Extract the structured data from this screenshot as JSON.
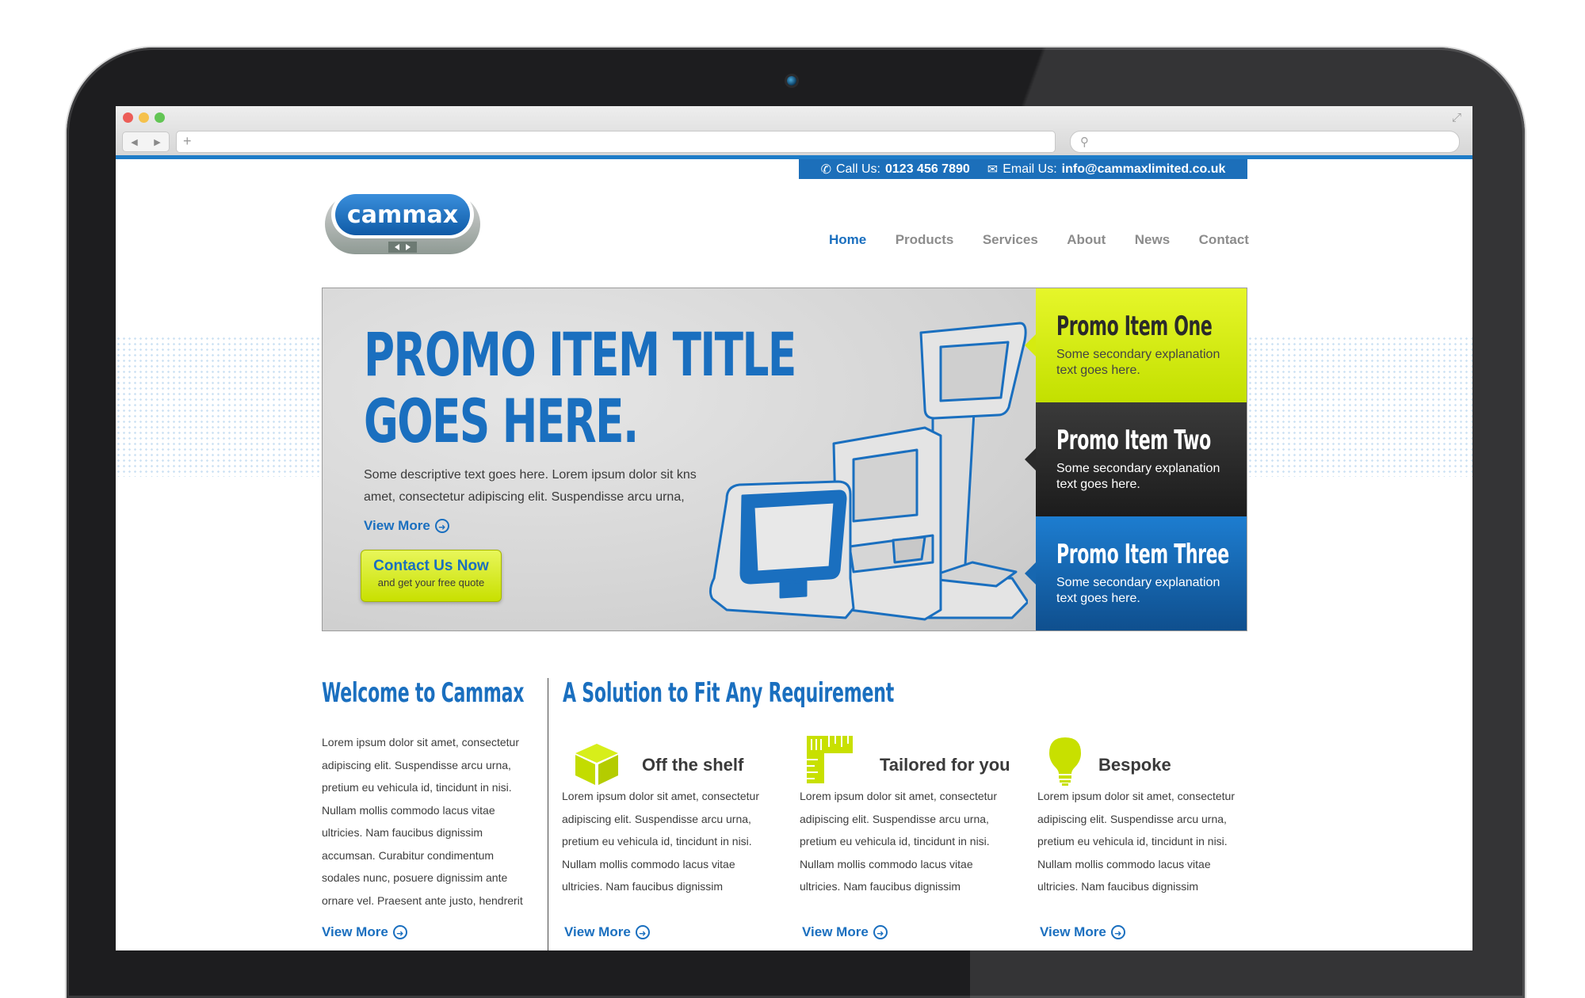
{
  "browser": {
    "nav_back": "◀",
    "nav_forward": "▶",
    "new_tab": "+"
  },
  "header": {
    "call_label": "Call Us:",
    "call_number": "0123 456 7890",
    "email_label": "Email Us:",
    "email_address": "info@cammaxlimited.co.uk",
    "logo_text": "cammax"
  },
  "nav": {
    "items": [
      "Home",
      "Products",
      "Services",
      "About",
      "News",
      "Contact"
    ],
    "active": "Home"
  },
  "hero": {
    "title_line1": "PROMO ITEM TITLE",
    "title_line2": "GOES HERE.",
    "description": "Some descriptive text goes here. Lorem ipsum dolor sit kns amet, consectetur adipiscing elit. Suspendisse arcu urna,",
    "view_more": "View More",
    "cta_title": "Contact Us Now",
    "cta_subtitle": "and get your free quote"
  },
  "promos": [
    {
      "title": "Promo Item One",
      "text": "Some secondary explanation text goes here."
    },
    {
      "title": "Promo Item Two",
      "text": "Some secondary explanation text goes here."
    },
    {
      "title": "Promo Item Three",
      "text": "Some secondary explanation text goes here."
    }
  ],
  "welcome": {
    "title": "Welcome to Cammax",
    "text": "Lorem ipsum dolor sit amet, consectetur adipiscing elit. Suspendisse arcu urna, pretium eu vehicula id, tincidunt in nisi. Nullam mollis commodo lacus vitae ultricies. Nam faucibus dignissim accumsan. Curabitur condimentum sodales nunc, posuere dignissim ante ornare vel. Praesent ante justo, hendrerit",
    "view_more": "View More"
  },
  "solution": {
    "title": "A Solution to Fit Any Requirement",
    "features": [
      {
        "icon": "box-icon",
        "title": "Off the shelf",
        "text": "Lorem ipsum dolor sit amet, consectetur adipiscing elit. Suspendisse arcu urna, pretium eu vehicula id, tincidunt in nisi. Nullam mollis commodo lacus vitae ultricies. Nam faucibus dignissim",
        "view_more": "View More"
      },
      {
        "icon": "ruler-icon",
        "title": "Tailored for you",
        "text": "Lorem ipsum dolor sit amet, consectetur adipiscing elit. Suspendisse arcu urna, pretium eu vehicula id, tincidunt in nisi. Nullam mollis commodo lacus vitae ultricies. Nam faucibus dignissim",
        "view_more": "View More"
      },
      {
        "icon": "lightbulb-icon",
        "title": "Bespoke",
        "text": "Lorem ipsum dolor sit amet, consectetur adipiscing elit. Suspendisse arcu urna, pretium eu vehicula id, tincidunt in nisi. Nullam mollis commodo lacus vitae ultricies. Nam faucibus dignissim",
        "view_more": "View More"
      }
    ]
  },
  "colors": {
    "brand_blue": "#1a6fbf",
    "accent_lime": "#c8e000",
    "dark": "#1c1c1c"
  }
}
